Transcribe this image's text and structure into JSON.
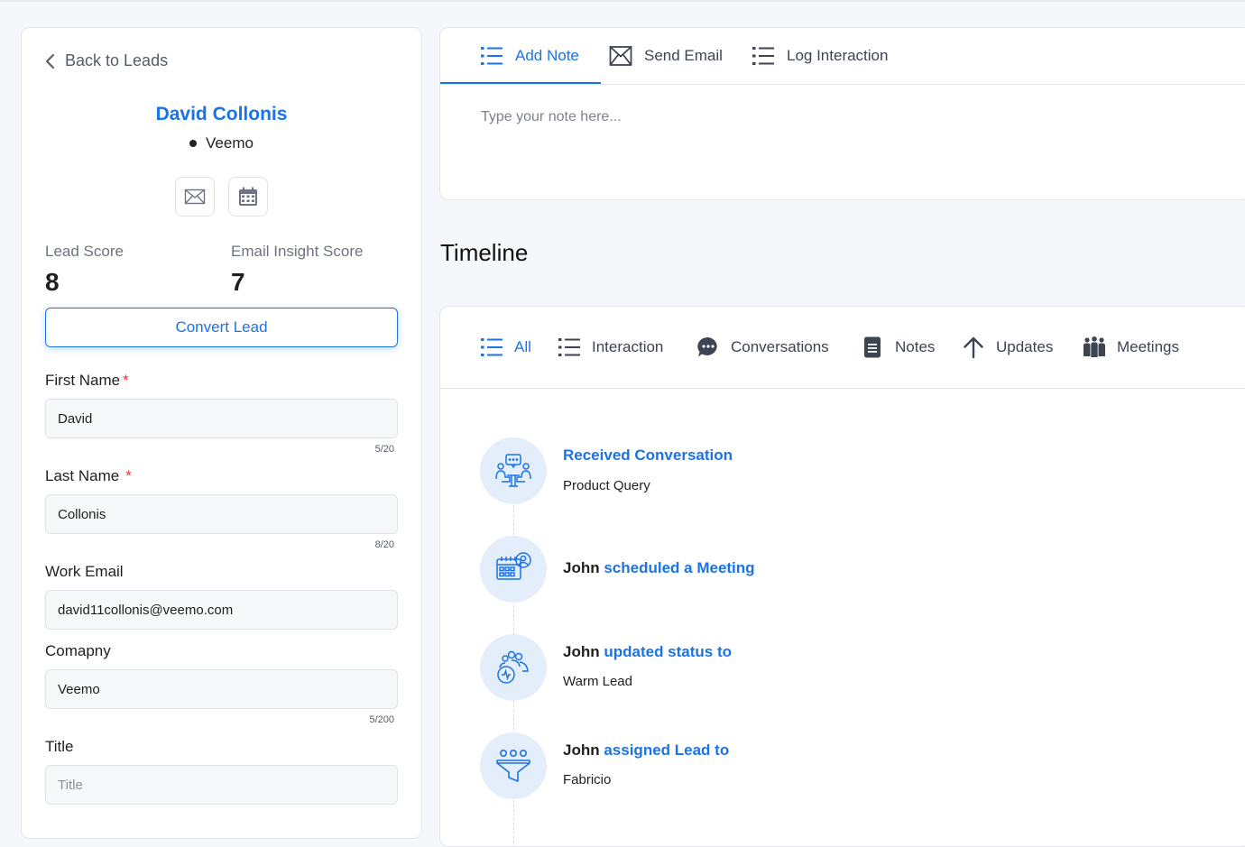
{
  "lead": {
    "back_label": "Back to Leads",
    "name": "David Collonis",
    "company": "Veemo",
    "lead_score_label": "Lead Score",
    "lead_score": "8",
    "email_score_label": "Email Insight Score",
    "email_score": "7",
    "convert_label": "Convert Lead"
  },
  "form": {
    "first_name": {
      "label": "First Name",
      "required": "*",
      "value": "David",
      "counter": "5/20"
    },
    "last_name": {
      "label": "Last Name",
      "required": "*",
      "value": "Collonis",
      "counter": "8/20"
    },
    "work_email": {
      "label": "Work Email",
      "value": "david11collonis@veemo.com"
    },
    "company": {
      "label": "Comapny",
      "value": "Veemo",
      "counter": "5/200"
    },
    "title": {
      "label": "Title",
      "placeholder": "Title"
    }
  },
  "note": {
    "tabs": [
      {
        "label": "Add Note",
        "icon": "list-icon"
      },
      {
        "label": "Send Email",
        "icon": "mail-icon"
      },
      {
        "label": "Log Interaction",
        "icon": "list-icon"
      }
    ],
    "placeholder": "Type your note here..."
  },
  "timeline": {
    "title": "Timeline",
    "tabs": [
      {
        "label": "All",
        "icon": "list-icon"
      },
      {
        "label": "Interaction",
        "icon": "list-icon"
      },
      {
        "label": "Conversations",
        "icon": "chat-icon"
      },
      {
        "label": "Notes",
        "icon": "document-icon"
      },
      {
        "label": "Updates",
        "icon": "arrow-up-icon"
      },
      {
        "label": "Meetings",
        "icon": "group-icon"
      }
    ],
    "items": [
      {
        "actor": "",
        "action": "Received Conversation",
        "detail": "Product Query",
        "icon": "conversation-icon"
      },
      {
        "actor": "John",
        "action": "scheduled a Meeting",
        "detail": "",
        "icon": "meeting-calendar-icon"
      },
      {
        "actor": "John",
        "action": "updated status to",
        "detail": "Warm Lead",
        "icon": "status-people-icon"
      },
      {
        "actor": "John",
        "action": "assigned Lead to",
        "detail": "Fabricio",
        "icon": "funnel-icon"
      }
    ]
  },
  "colors": {
    "accent": "#1a73e8",
    "icon_bg": "#e3eefa",
    "required": "#e53935"
  }
}
